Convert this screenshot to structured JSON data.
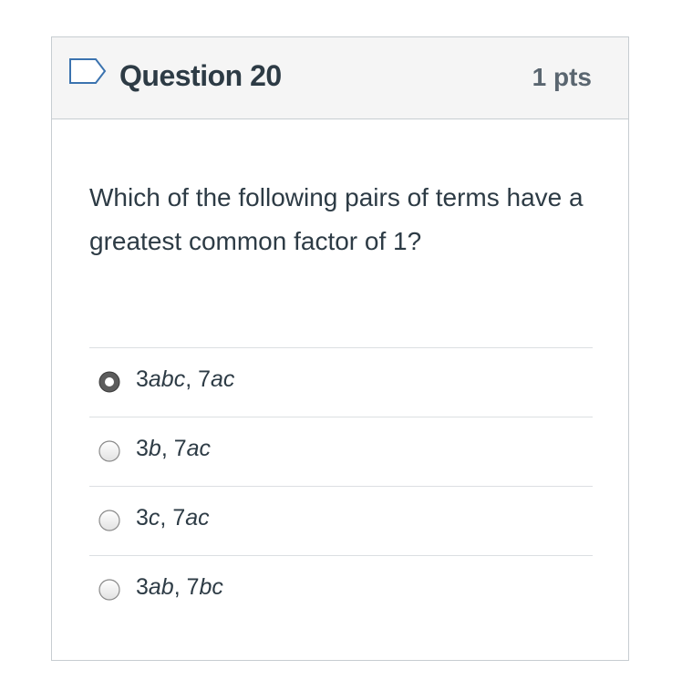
{
  "question": {
    "title": "Question 20",
    "points": "1 pts",
    "text": "Which of the following pairs of terms have a greatest common factor of 1?",
    "flag_icon": "flag-outline-icon"
  },
  "answers": [
    {
      "coef1": "3",
      "var1": "abc",
      "coef2": "7",
      "var2": "ac",
      "selected": true
    },
    {
      "coef1": "3",
      "var1": "b",
      "coef2": "7",
      "var2": "ac",
      "selected": false
    },
    {
      "coef1": "3",
      "var1": "c",
      "coef2": "7",
      "var2": "ac",
      "selected": false
    },
    {
      "coef1": "3",
      "var1": "ab",
      "coef2": "7",
      "var2": "bc",
      "selected": false
    }
  ],
  "colors": {
    "header_bg": "#f5f5f5",
    "border": "#c7cdd1",
    "text": "#2d3b45",
    "points": "#5a6670",
    "flag": "#3b73af"
  }
}
